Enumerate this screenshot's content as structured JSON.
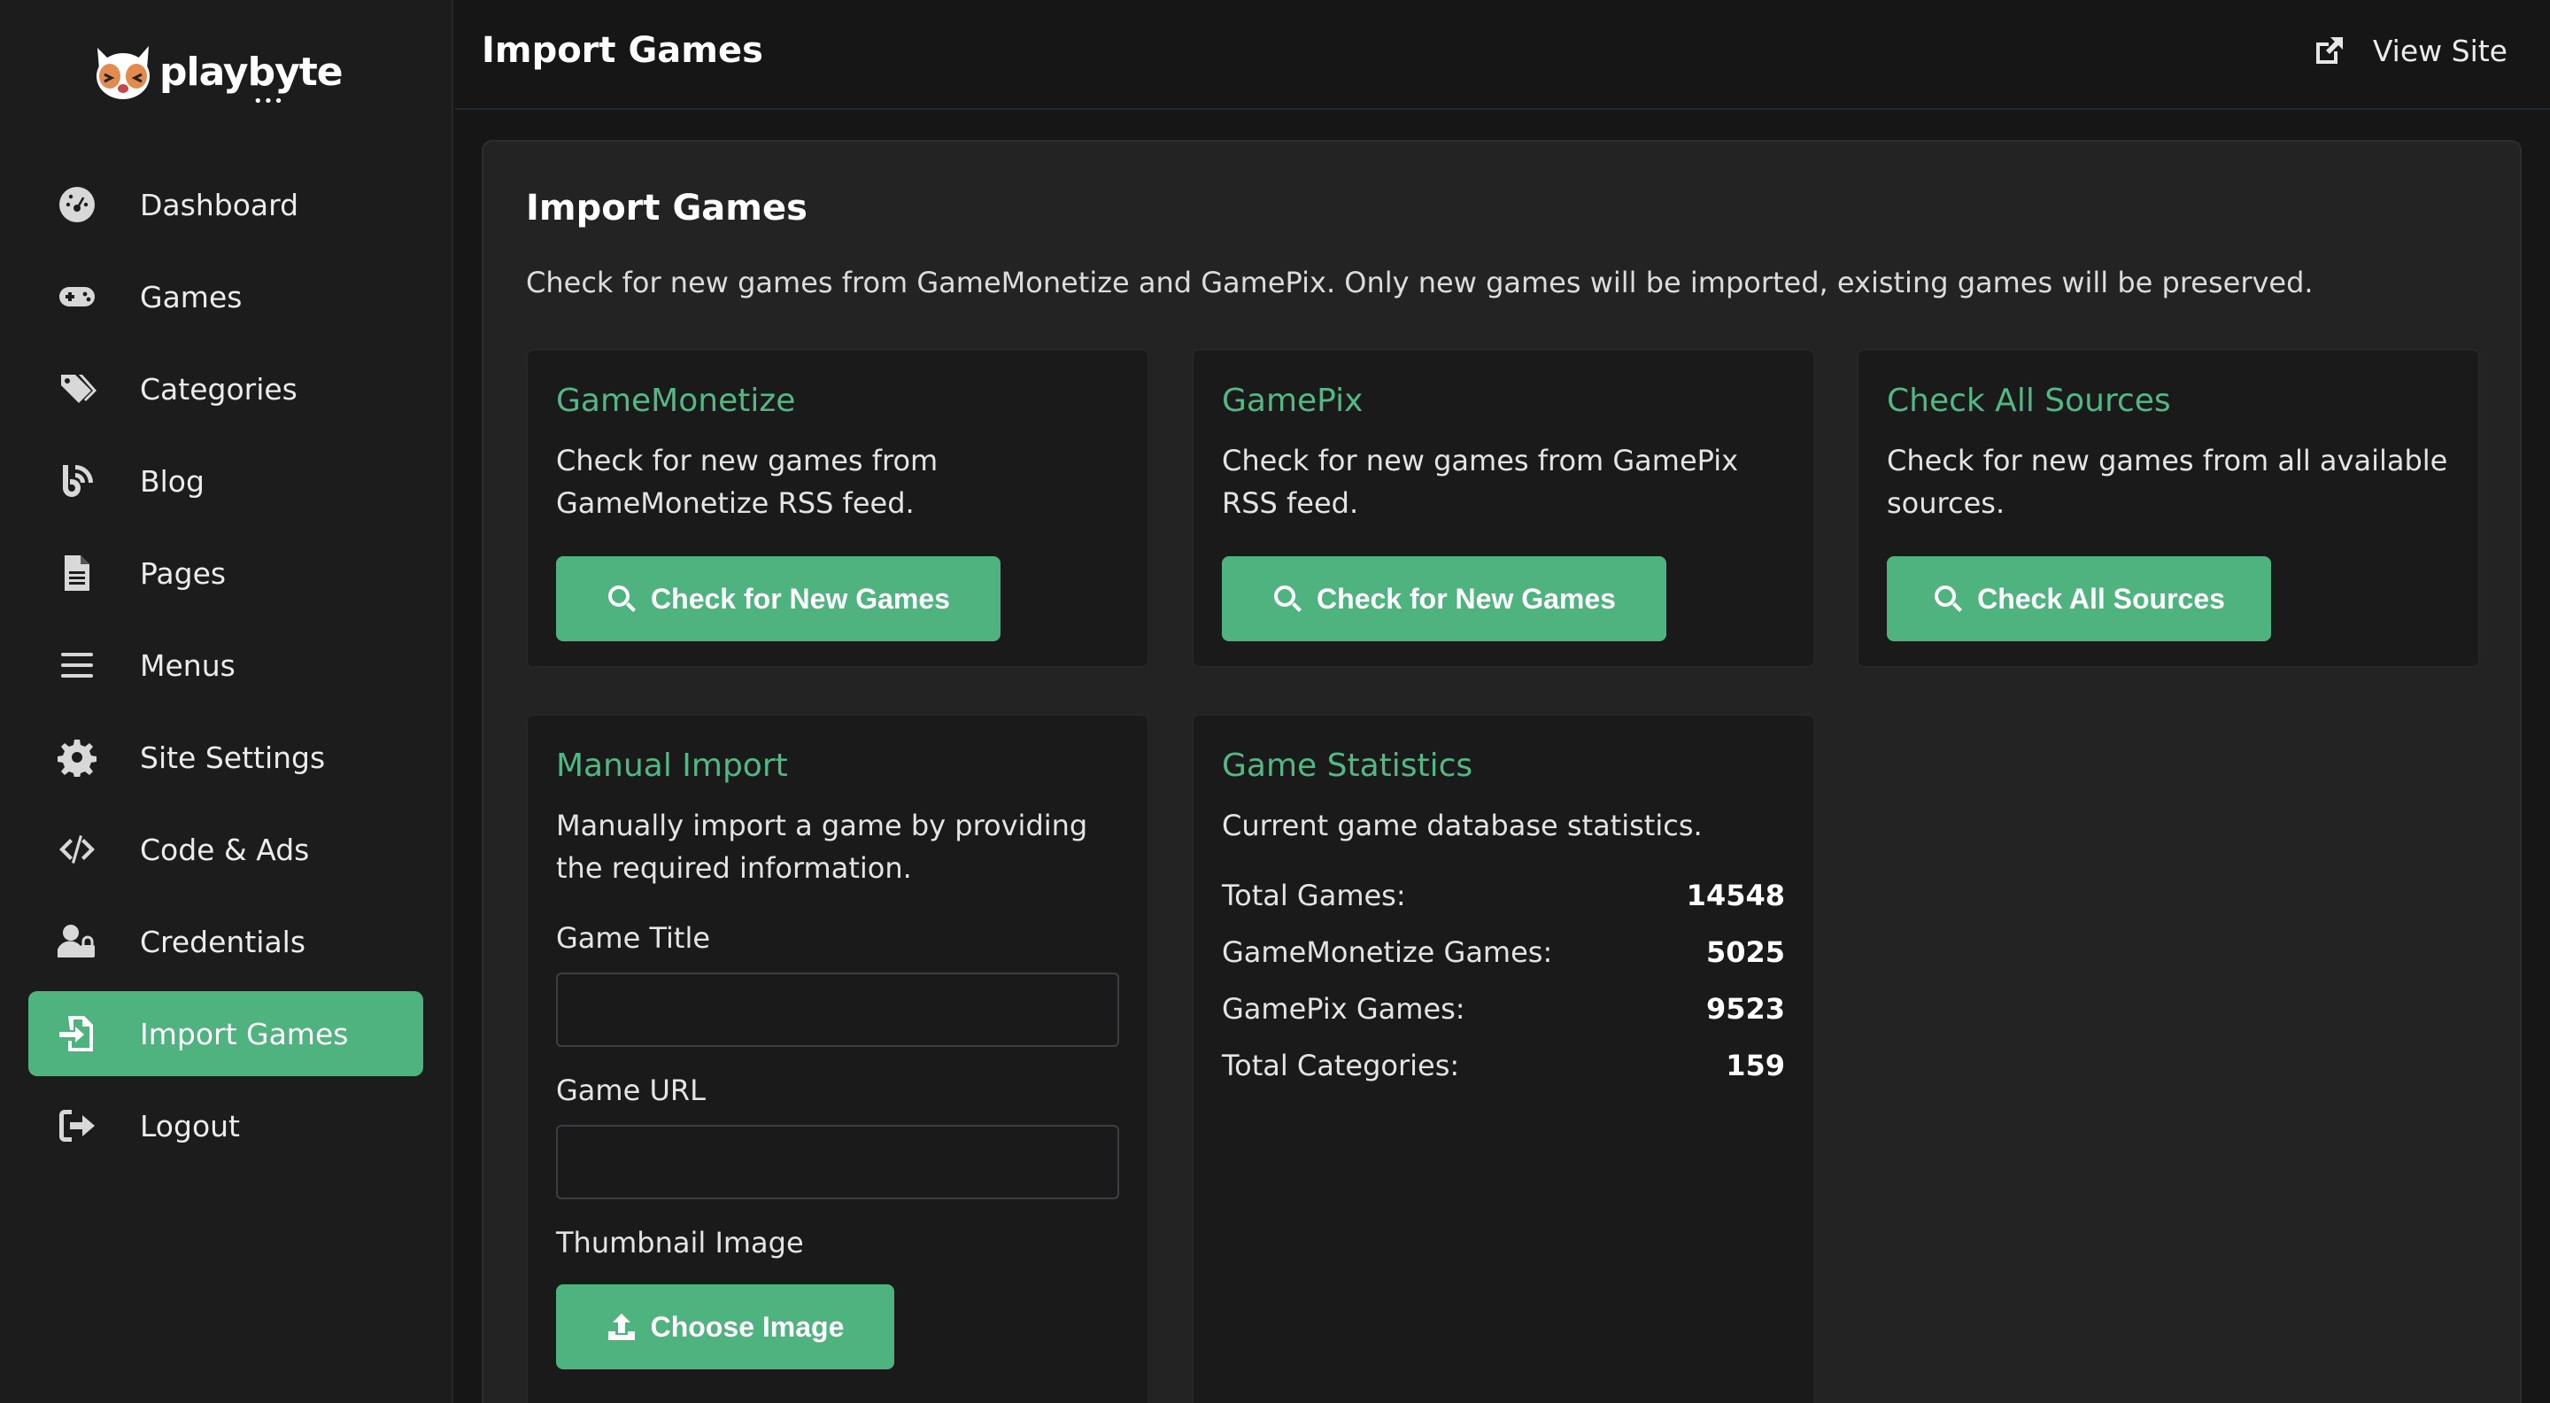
{
  "sidebar": {
    "logo_text": "playbyte",
    "logo_dots": "•••",
    "items": [
      {
        "label": "Dashboard"
      },
      {
        "label": "Games"
      },
      {
        "label": "Categories"
      },
      {
        "label": "Blog"
      },
      {
        "label": "Pages"
      },
      {
        "label": "Menus"
      },
      {
        "label": "Site Settings"
      },
      {
        "label": "Code & Ads"
      },
      {
        "label": "Credentials"
      },
      {
        "label": "Import Games"
      },
      {
        "label": "Logout"
      }
    ],
    "active_item": "Import Games"
  },
  "header": {
    "title": "Import Games",
    "view_site_label": "View Site"
  },
  "main": {
    "title": "Import Games",
    "description": "Check for new games from GameMonetize and GamePix. Only new games will be imported, existing games will be preserved.",
    "sources": [
      {
        "title": "GameMonetize",
        "description": "Check for new games from GameMonetize RSS feed.",
        "button": "Check for New Games"
      },
      {
        "title": "GamePix",
        "description": "Check for new games from GamePix RSS feed.",
        "button": "Check for New Games"
      },
      {
        "title": "Check All Sources",
        "description": "Check for new games from all available sources.",
        "button": "Check All Sources"
      }
    ],
    "manual_import": {
      "title": "Manual Import",
      "description": "Manually import a game by providing the required information.",
      "game_title_label": "Game Title",
      "game_title_value": "",
      "game_url_label": "Game URL",
      "game_url_value": "",
      "thumbnail_label": "Thumbnail Image",
      "choose_image_button": "Choose Image"
    },
    "stats": {
      "title": "Game Statistics",
      "description": "Current game database statistics.",
      "rows": [
        {
          "label": "Total Games:",
          "value": "14548"
        },
        {
          "label": "GameMonetize Games:",
          "value": "5025"
        },
        {
          "label": "GamePix Games:",
          "value": "9523"
        },
        {
          "label": "Total Categories:",
          "value": "159"
        }
      ]
    }
  },
  "colors": {
    "accent": "#4fb380",
    "accent_text": "#53b884",
    "background": "#161616",
    "sidebar": "#1c1c1c",
    "panel": "#232323",
    "card": "#1a1a1a"
  }
}
